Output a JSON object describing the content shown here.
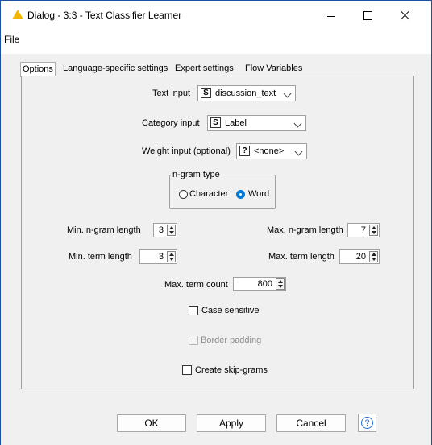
{
  "window": {
    "title": "Dialog - 3:3 - Text Classifier Learner",
    "title_icon": "warning-triangle-icon",
    "controls": [
      "minimize",
      "maximize",
      "close"
    ]
  },
  "menu": {
    "file": "File"
  },
  "tabs": [
    {
      "label": "Options",
      "active": true
    },
    {
      "label": "Language-specific settings",
      "active": false
    },
    {
      "label": "Expert settings",
      "active": false
    },
    {
      "label": "Flow Variables",
      "active": false
    }
  ],
  "options": {
    "text_input": {
      "label": "Text input",
      "type_badge": "S",
      "value": "discussion_text"
    },
    "category_input": {
      "label": "Category input",
      "type_badge": "S",
      "value": "Label"
    },
    "weight_input": {
      "label": "Weight input (optional)",
      "type_badge": "?",
      "value": "<none>"
    },
    "ngram_type": {
      "title": "n-gram type",
      "options": [
        {
          "label": "Character",
          "selected": false
        },
        {
          "label": "Word",
          "selected": true
        }
      ]
    },
    "min_ngram_length": {
      "label": "Min. n-gram length",
      "value": "3"
    },
    "max_ngram_length": {
      "label": "Max. n-gram length",
      "value": "7"
    },
    "min_term_length": {
      "label": "Min. term length",
      "value": "3"
    },
    "max_term_length": {
      "label": "Max. term length",
      "value": "20"
    },
    "max_term_count": {
      "label": "Max. term count",
      "value": "800"
    },
    "case_sensitive": {
      "label": "Case sensitive",
      "checked": false,
      "enabled": true
    },
    "border_padding": {
      "label": "Border padding",
      "checked": false,
      "enabled": false
    },
    "create_skipgrams": {
      "label": "Create skip-grams",
      "checked": false,
      "enabled": true
    }
  },
  "buttons": {
    "ok": "OK",
    "apply": "Apply",
    "cancel": "Cancel",
    "help_icon": "help-icon"
  },
  "colors": {
    "accent": "#0078d7",
    "window_border": "#1f4fa0",
    "warning": "#f2b600"
  }
}
